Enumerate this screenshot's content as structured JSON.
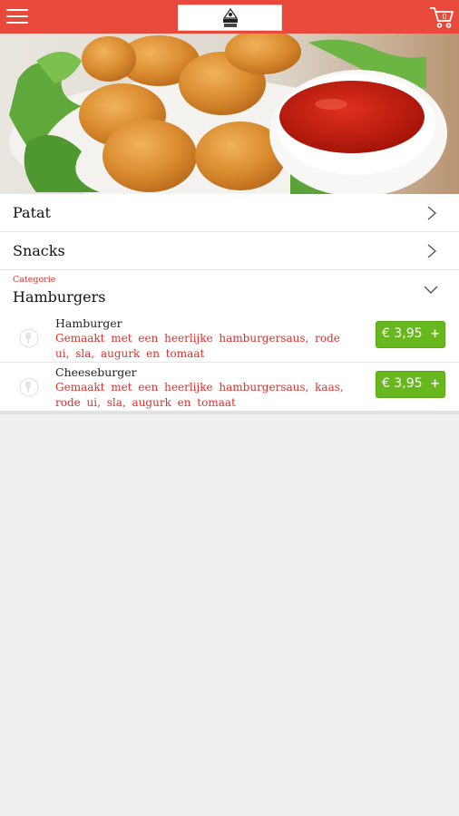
{
  "categories": [
    {
      "label": "Patat"
    },
    {
      "label": "Snacks"
    }
  ],
  "open_category": {
    "small_label": "Categorie",
    "label": "Hamburgers",
    "items": [
      {
        "name": "Hamburger",
        "description": "Gemaakt met een heerlijke hamburgersaus, rode ui, sla, augurk en tomaat",
        "price": "€ 3,95",
        "add": "+"
      },
      {
        "name": "Cheeseburger",
        "description": "Gemaakt met een heerlijke hamburgersaus, kaas, rode ui, sla, augurk en tomaat",
        "price": "€ 3,95",
        "add": "+"
      }
    ]
  },
  "colors": {
    "brand": "#e8493b",
    "accent_text": "#d8312c",
    "price_button": "#66b81e"
  },
  "icons": {
    "menu": "hamburger-menu-icon",
    "cart": "shopping-cart-icon",
    "row": "chevron-right-icon",
    "open": "chevron-down-icon",
    "item": "cutlery-icon"
  }
}
